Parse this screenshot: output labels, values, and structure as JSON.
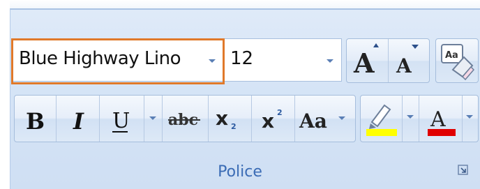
{
  "font_group": {
    "font_name_value": "Blue Highway Lino",
    "font_size_value": "12",
    "grow_font_glyph": "A",
    "shrink_font_glyph": "A",
    "bold_glyph": "B",
    "italic_glyph": "I",
    "underline_glyph": "U",
    "strikethrough_glyph": "abc",
    "subscript_glyph": "x",
    "subscript_mark": "2",
    "superscript_glyph": "x",
    "superscript_mark": "2",
    "change_case_glyph": "Aa",
    "font_color_glyph": "A",
    "group_label": "Police"
  },
  "colors": {
    "highlight_color": "#ffff00",
    "font_color": "#e00000",
    "selection_box": "#e0792a",
    "group_label_color": "#3b6cb5"
  },
  "icons": [
    "chevron-down-icon",
    "grow-font-icon",
    "shrink-font-icon",
    "clear-formatting-icon",
    "highlighter-icon",
    "dialog-launcher-icon"
  ]
}
